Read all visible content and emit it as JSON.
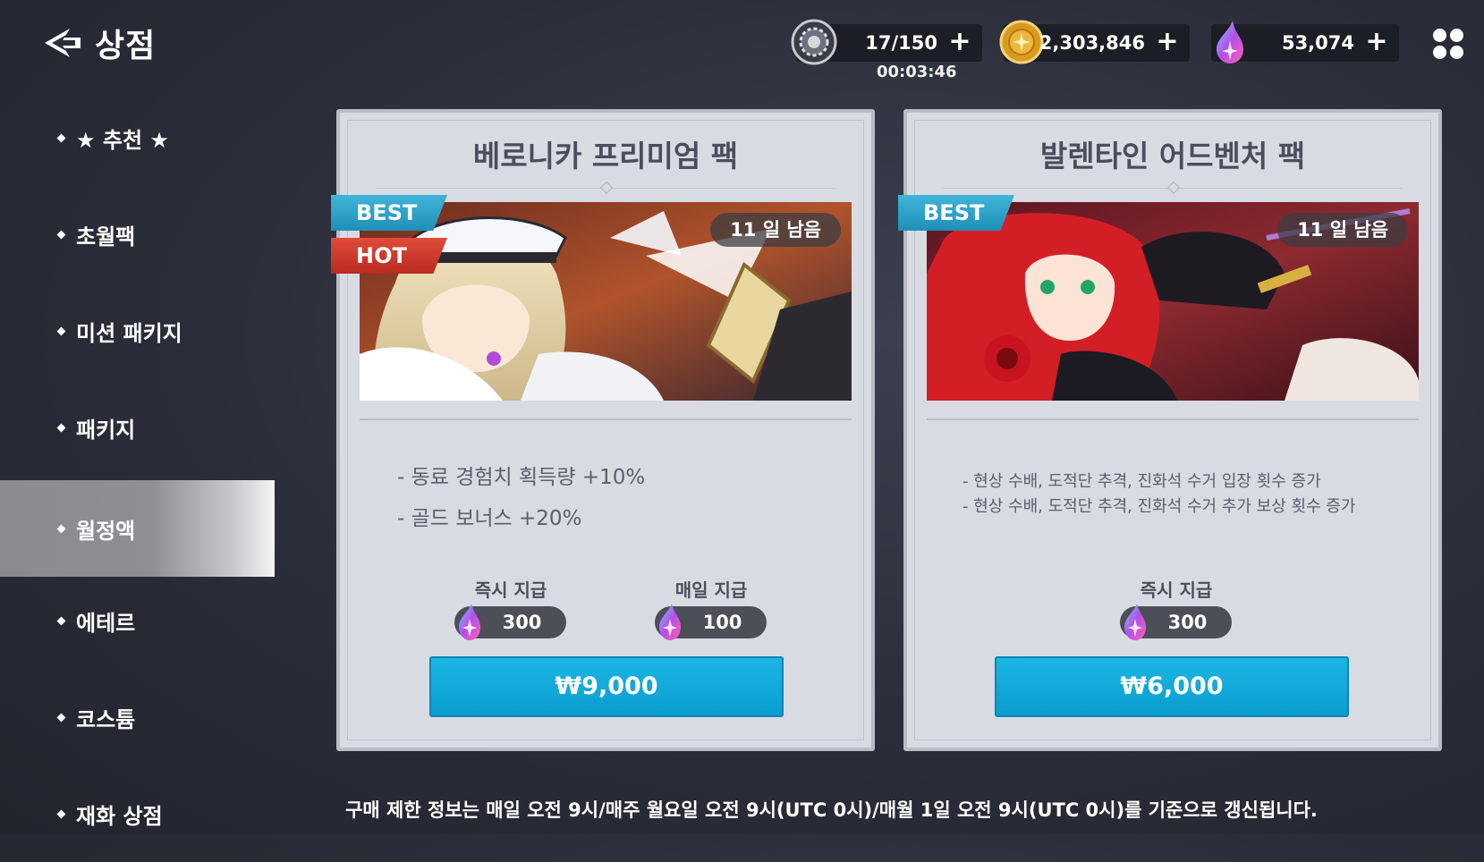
{
  "header": {
    "title": "상점",
    "back_icon": "back-arrow-icon",
    "resources": [
      {
        "name": "stamina",
        "icon": "stamina-gear-icon",
        "value": "17/150",
        "plus": "+"
      },
      {
        "name": "gold",
        "icon": "gold-coin-icon",
        "value": "2,303,846",
        "plus": "+"
      },
      {
        "name": "gems",
        "icon": "crystal-gem-icon",
        "value": "53,074",
        "plus": "+"
      }
    ],
    "timer": "00:03:46",
    "menu_icon": "grid-menu-icon"
  },
  "sidebar": {
    "items": [
      {
        "label": "★ 추천 ★"
      },
      {
        "label": "초월팩"
      },
      {
        "label": "미션 패키지"
      },
      {
        "label": "패키지"
      },
      {
        "label": "월정액",
        "active": true
      },
      {
        "label": "에테르"
      },
      {
        "label": "코스튬"
      },
      {
        "label": "재화 상점"
      }
    ]
  },
  "cards": [
    {
      "title": "베로니카 프리미엄 팩",
      "tags": [
        "BEST",
        "HOT"
      ],
      "days_left": "11 일 남음",
      "benefits": [
        "- 동료 경험치 획득량 +10%",
        "- 골드 보너스 +20%"
      ],
      "rewards": [
        {
          "label": "즉시 지급",
          "amount": "300"
        },
        {
          "label": "매일 지급",
          "amount": "100"
        }
      ],
      "price": "₩9,000"
    },
    {
      "title": "발렌타인 어드벤처 팩",
      "tags": [
        "BEST"
      ],
      "days_left": "11 일 남음",
      "benefits": [
        "- 현상 수배, 도적단 추격, 진화석 수거 입장 횟수 증가",
        "- 현상 수배, 도적단 추격, 진화석 수거 추가 보상 횟수 증가"
      ],
      "rewards": [
        {
          "label": "즉시 지급",
          "amount": "300"
        }
      ],
      "price": "₩6,000"
    }
  ],
  "footer": "구매 제한 정보는 매일 오전 9시/매주 월요일 오전 9시(UTC 0시)/매월 1일 오전 9시(UTC 0시)를 기준으로 갱신됩니다.",
  "colors": {
    "accent": "#0fa8da",
    "best": "#2aa3cc",
    "hot": "#cf3a2c",
    "card_bg": "#d9dbe3"
  }
}
